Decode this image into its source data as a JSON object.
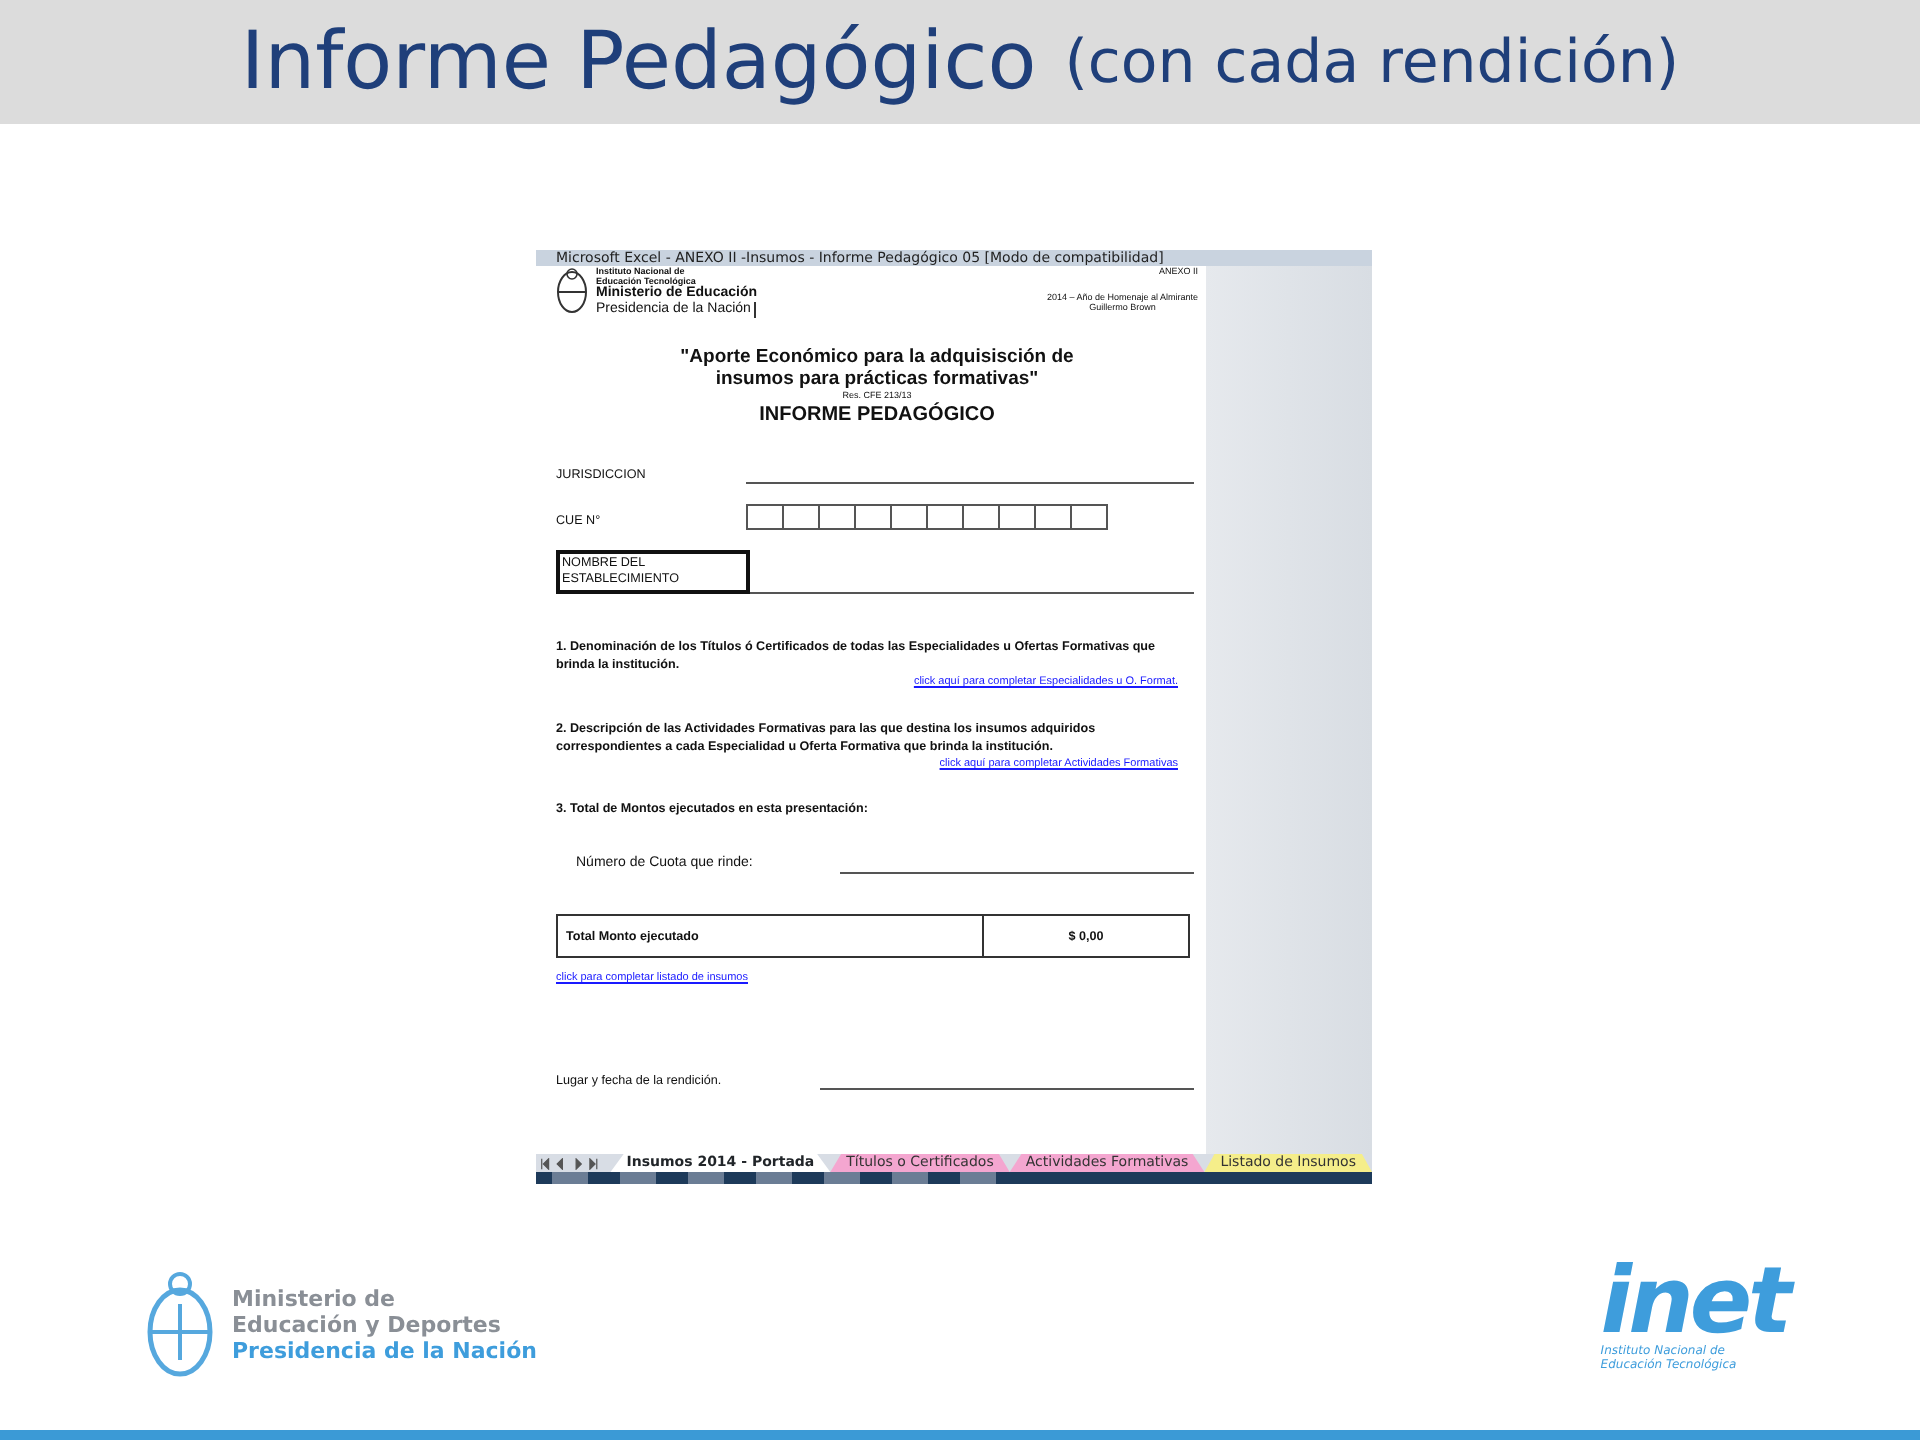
{
  "slide": {
    "title": "Informe Pedagógico",
    "subtitle": "(con cada rendición)"
  },
  "screenshot": {
    "window_title": "Microsoft Excel - ANEXO II -Insumos - Informe Pedagógico 05  [Modo de compatibilidad]",
    "sheet": {
      "header": {
        "institute_lines": [
          "Instituto Nacional de",
          "Educación Tecnológica"
        ],
        "ministry": "Ministerio de Educación",
        "presidency": "Presidencia de la Nación",
        "annex": "ANEXO II",
        "motto_lines": [
          "2014 – Año de Homenaje al Almirante",
          "Guillermo Brown"
        ]
      },
      "title_lines": [
        "\"Aporte Económico para la adquisisción de",
        "insumos para prácticas formativas\""
      ],
      "resolution": "Res. CFE 213/13",
      "heading": "INFORME PEDAGÓGICO",
      "fields": [
        {
          "kind": "line",
          "label": "JURISDICCION"
        },
        {
          "kind": "boxes",
          "label": "CUE N°"
        },
        {
          "kind": "selected-cell",
          "label": "NOMBRE DEL ESTABLECIMIENTO"
        }
      ],
      "items": [
        {
          "text": "1. Denominación de los Títulos ó Certificados de todas las Especialidades u Ofertas Formativas que brinda la institución.",
          "link": "click aquí para completar Especialidades u O. Format."
        },
        {
          "text": "2. Descripción de las Actividades Formativas para las que destina los insumos adquiridos correspondientes a cada Especialidad u Oferta Formativa que brinda la institución.",
          "link": "click aquí para completar Actividades Formativas"
        },
        {
          "text": "3. Total de Montos ejecutados en esta presentación:"
        }
      ],
      "cuota_label": "Número de Cuota que rinde:",
      "total": {
        "label": "Total Monto ejecutado",
        "value": "$ 0,00"
      },
      "total_link": "click para completar listado de insumos",
      "place_date_label": "Lugar y fecha de la rendición."
    },
    "sheet_tabs": [
      {
        "label": "Insumos 2014 - Portada",
        "selected": true,
        "color": "#ffffff"
      },
      {
        "label": "Títulos o Certificados",
        "selected": false,
        "color": "#f4a6d0"
      },
      {
        "label": "Actividades Formativas",
        "selected": false,
        "color": "#f4a6d0"
      },
      {
        "label": "Listado de Insumos",
        "selected": false,
        "color": "#f5ee8a"
      }
    ]
  },
  "footer": {
    "left_logo": {
      "lines": [
        "Ministerio de",
        "Educación y Deportes"
      ],
      "presidency": "Presidencia de la Nación"
    },
    "right_logo": {
      "wordmark": "inet",
      "lines": [
        "Instituto Nacional de",
        "Educación Tecnológica"
      ]
    }
  }
}
